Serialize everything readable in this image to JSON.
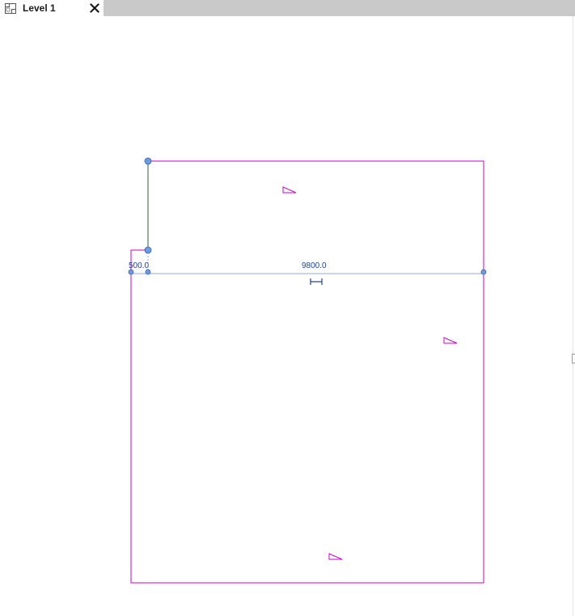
{
  "view_tab": {
    "label": "Level 1",
    "icon": "floor-plan-view-icon",
    "close_icon": "close-icon"
  },
  "drawing": {
    "dimensions": {
      "left": "500.0",
      "main": "9800.0"
    },
    "colors": {
      "boundary": "#cc00cc",
      "dimension": "#1f3f9a",
      "selected_wall": "#2f5f3f",
      "grip": "#6e9be0",
      "reference_line": "#8fa8e8"
    }
  }
}
